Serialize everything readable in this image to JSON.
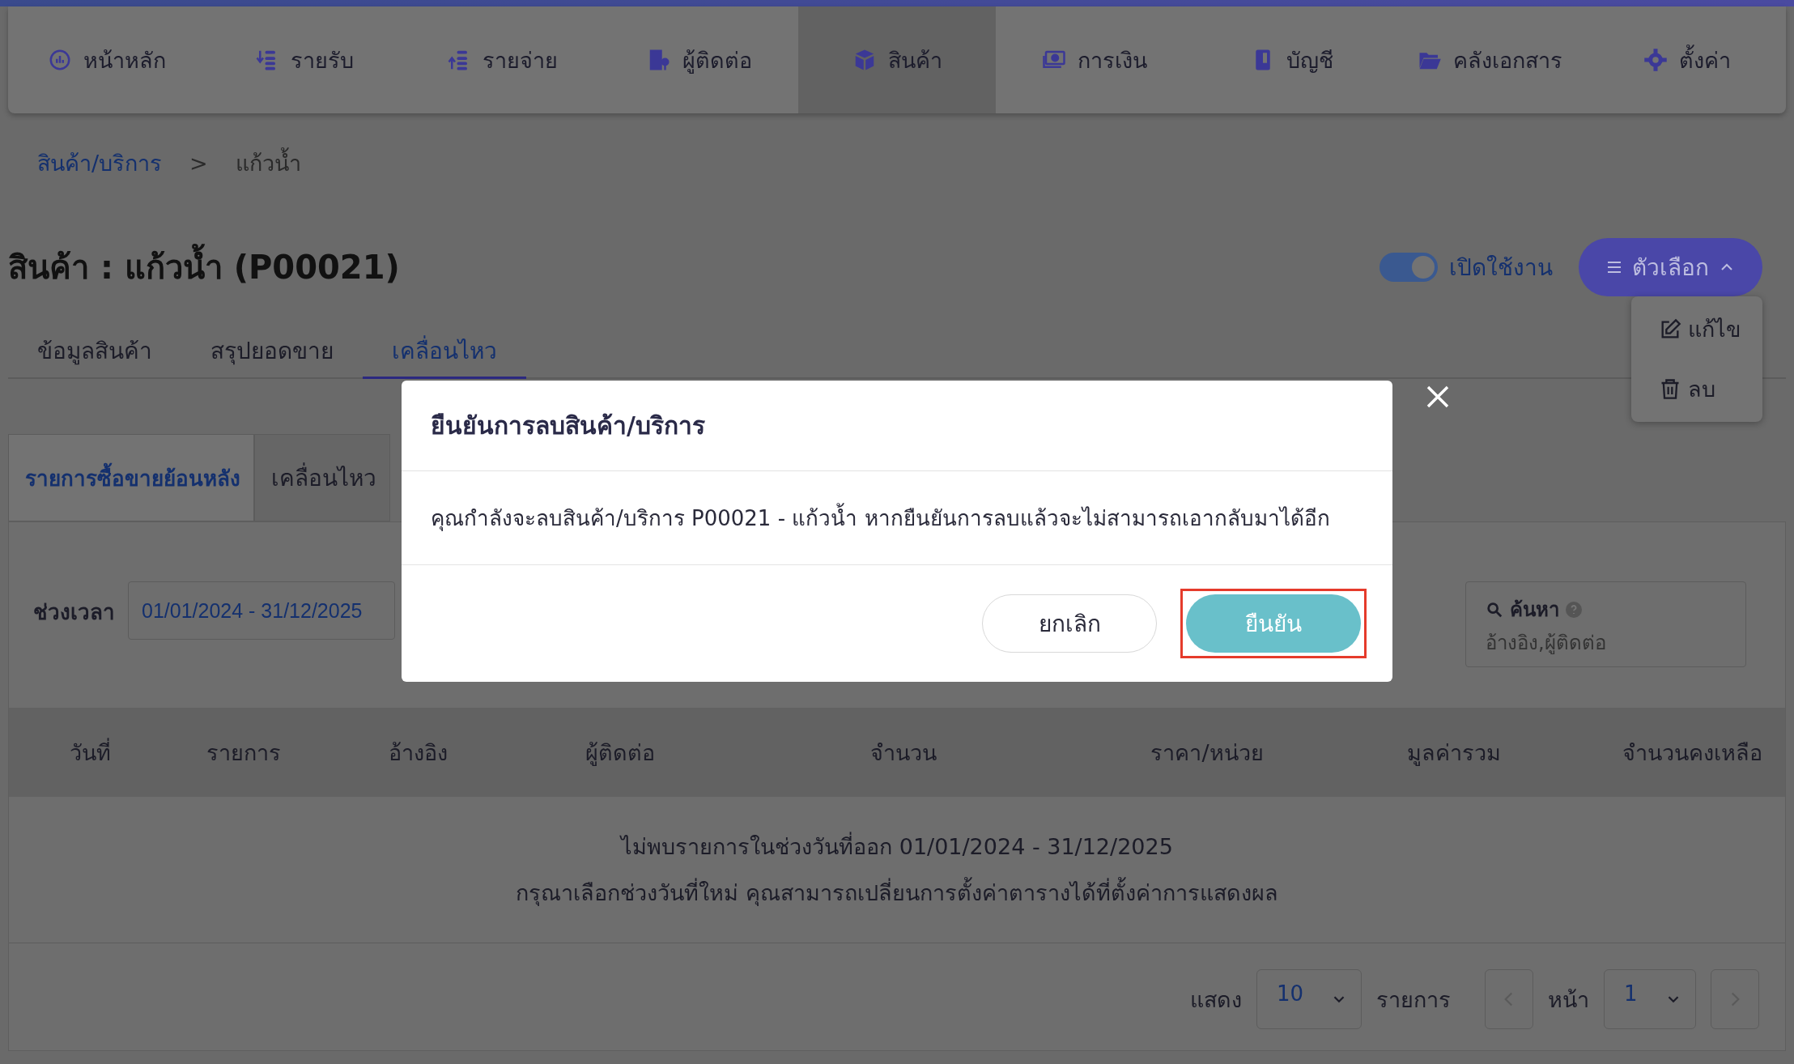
{
  "nav": {
    "items": [
      {
        "label": "หน้าหลัก",
        "selected": false
      },
      {
        "label": "รายรับ",
        "selected": false
      },
      {
        "label": "รายจ่าย",
        "selected": false
      },
      {
        "label": "ผู้ติดต่อ",
        "selected": false
      },
      {
        "label": "สินค้า",
        "selected": true
      },
      {
        "label": "การเงิน",
        "selected": false
      },
      {
        "label": "บัญชี",
        "selected": false
      },
      {
        "label": "คลังเอกสาร",
        "selected": false
      },
      {
        "label": "ตั้งค่า",
        "selected": false
      }
    ]
  },
  "breadcrumb": {
    "items": [
      "สินค้า/บริการ",
      "แก้วน้ำ"
    ],
    "separator": ">"
  },
  "title": "สินค้า : แก้วน้ำ (P00021)",
  "status_toggle": {
    "label": "เปิดใช้งาน",
    "on": true
  },
  "options_button": {
    "label": "ตัวเลือก",
    "expanded": true
  },
  "options_menu": {
    "items": [
      {
        "label": "แก้ไข"
      },
      {
        "label": "ลบ"
      }
    ]
  },
  "tabs": [
    {
      "label": "ข้อมูลสินค้า",
      "selected": false
    },
    {
      "label": "สรุปยอดขาย",
      "selected": false
    },
    {
      "label": "เคลื่อนไหว",
      "selected": true
    }
  ],
  "sub_tabs": [
    {
      "label": "รายการซื้อขายย้อนหลัง",
      "selected": true
    },
    {
      "label": "เคลื่อนไหว",
      "selected": false
    }
  ],
  "filter": {
    "label": "ช่วงเวลา",
    "value": "01/01/2024 - 31/12/2025"
  },
  "search": {
    "label": "ค้นหา",
    "placeholder": "อ้างอิง,ผู้ติดต่อ"
  },
  "table": {
    "columns": [
      "วันที่",
      "รายการ",
      "อ้างอิง",
      "ผู้ติดต่อ",
      "จำนวน",
      "ราคา/หน่วย",
      "มูลค่ารวม",
      "จำนวนคงเหลือ"
    ],
    "empty_message": [
      "ไม่พบรายการในช่วงวันที่ออก 01/01/2024 - 31/12/2025",
      "กรุณาเลือกช่วงวันที่ใหม่ คุณสามารถเปลี่ยนการตั้งค่าตารางได้ที่ตั้งค่าการแสดงผล"
    ]
  },
  "pagination": {
    "show_label": "แสดง",
    "per_page": "10",
    "unit_label": "รายการ",
    "page_label": "หน้า",
    "page": "1"
  },
  "dialog": {
    "title": "ยืนยันการลบสินค้า/บริการ",
    "message": "คุณกำลังจะลบสินค้า/บริการ P00021 - แก้วน้ำ หากยืนยันการลบแล้วจะไม่สามารถเอากลับมาได้อีก",
    "buttons": [
      {
        "label": "ยกเลิก",
        "kind": "secondary",
        "highlighted": false
      },
      {
        "label": "ยืนยัน",
        "kind": "primary",
        "highlighted": true
      }
    ]
  }
}
